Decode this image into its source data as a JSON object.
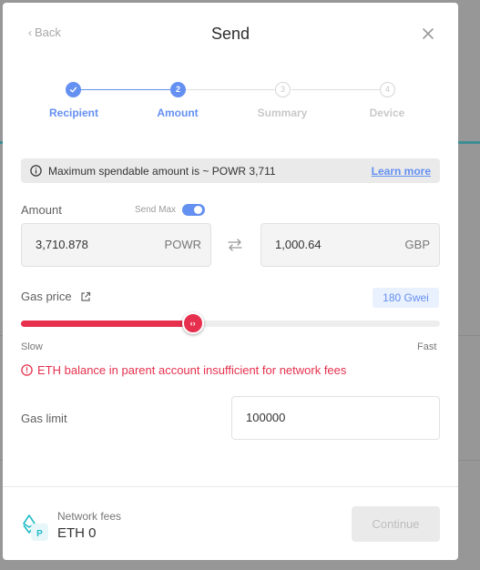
{
  "header": {
    "back_label": "Back",
    "title": "Send"
  },
  "stepper": {
    "steps": [
      {
        "number": "1",
        "label": "Recipient",
        "state": "done"
      },
      {
        "number": "2",
        "label": "Amount",
        "state": "active"
      },
      {
        "number": "3",
        "label": "Summary",
        "state": "todo"
      },
      {
        "number": "4",
        "label": "Device",
        "state": "todo"
      }
    ]
  },
  "info": {
    "text": "Maximum spendable amount is ~ POWR 3,711",
    "link": "Learn more"
  },
  "amount": {
    "label": "Amount",
    "send_max_label": "Send Max",
    "send_max_on": true,
    "crypto_value": "3,710.878",
    "crypto_unit": "POWR",
    "fiat_value": "1,000.64",
    "fiat_unit": "GBP"
  },
  "gas_price": {
    "label": "Gas price",
    "value": "180 Gwei",
    "slider_fraction": 0.41,
    "min_label": "Slow",
    "max_label": "Fast"
  },
  "error": {
    "text": "ETH balance in parent account insufficient for network fees"
  },
  "gas_limit": {
    "label": "Gas limit",
    "value": "100000"
  },
  "footer": {
    "network_fees_label": "Network fees",
    "network_fees_value": "ETH 0",
    "continue_label": "Continue"
  },
  "colors": {
    "accent": "#6490f1",
    "error": "#e6304d",
    "coin": "#1fbcc6"
  },
  "icons": [
    "check-icon",
    "close-icon",
    "info-icon",
    "swap-icon",
    "external-link-icon",
    "slider-arrows-icon",
    "error-icon",
    "ethereum-coin-icon"
  ]
}
